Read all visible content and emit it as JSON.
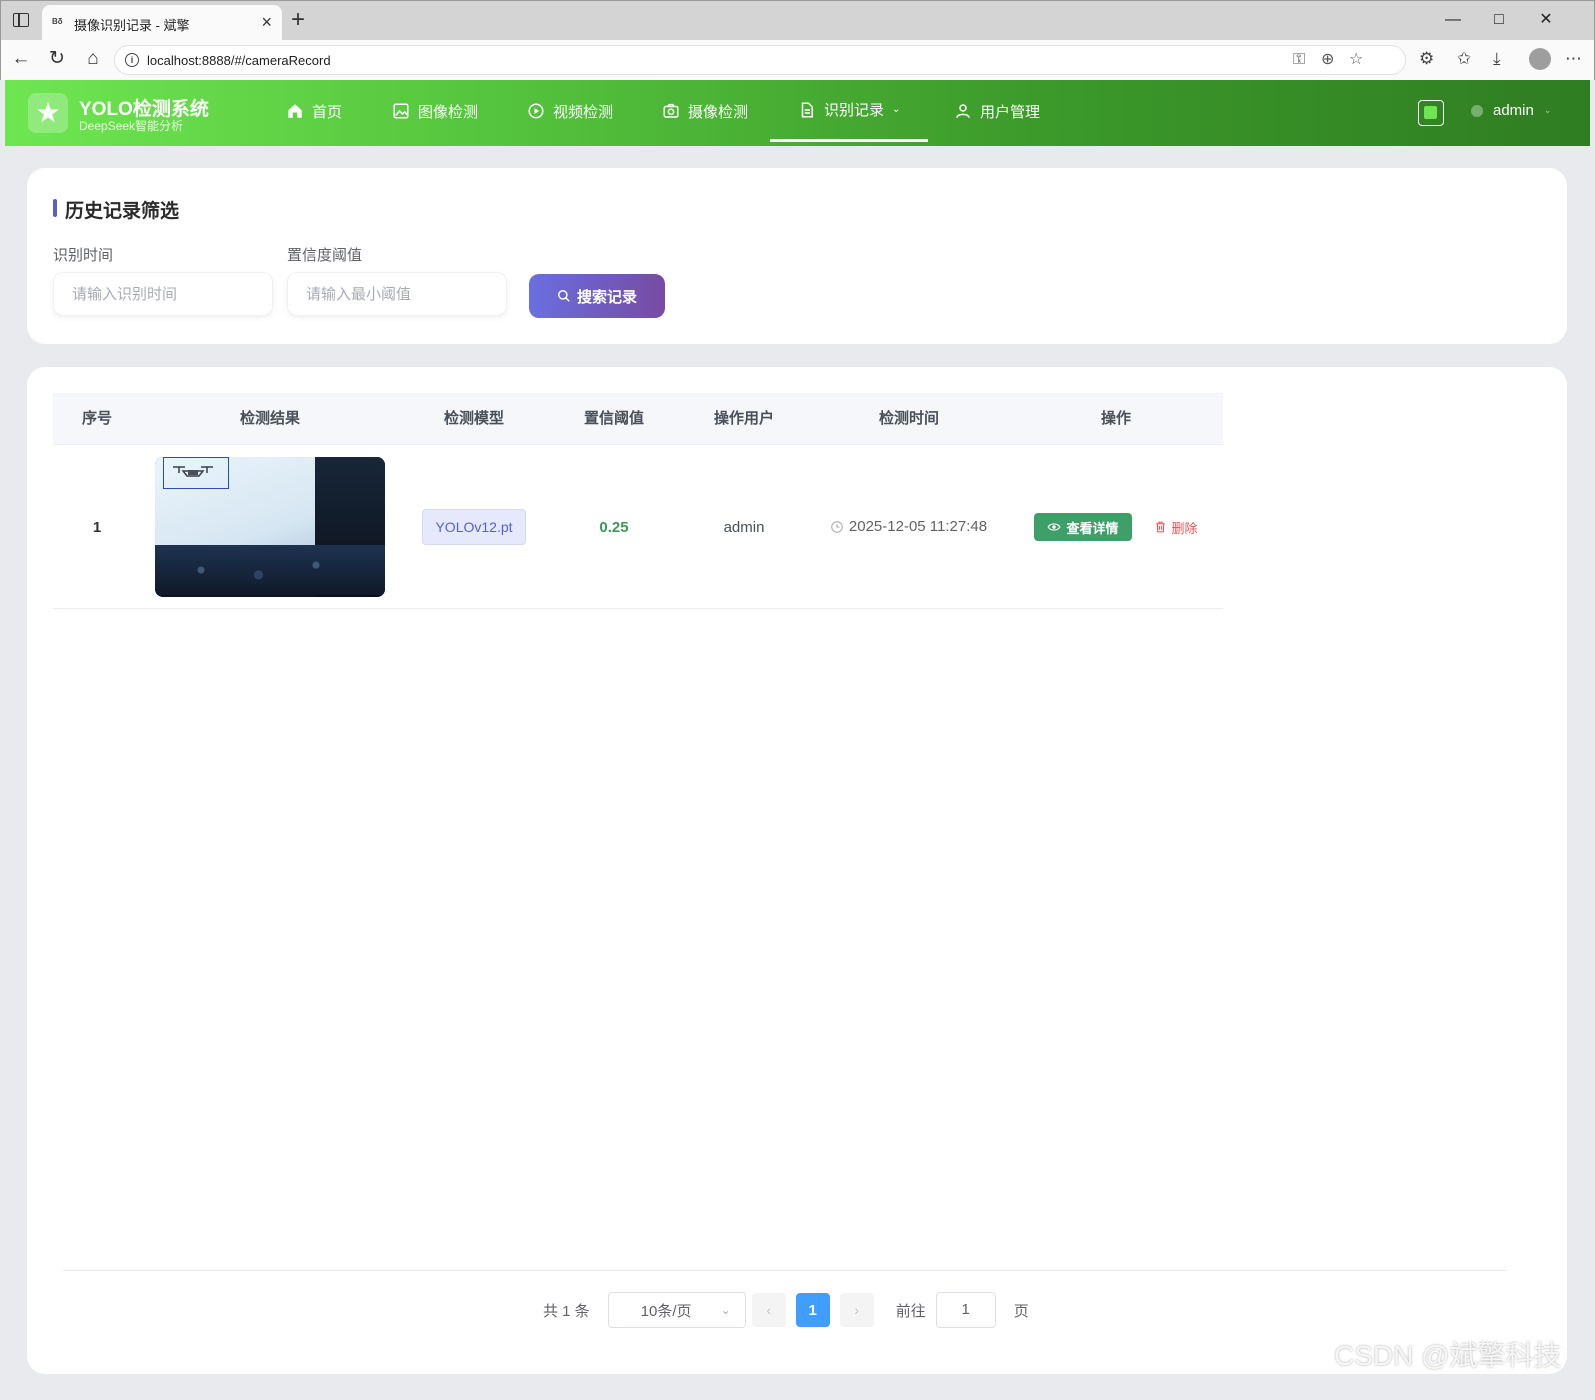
{
  "browser": {
    "tab_favicon": "Bδ",
    "tab_title": "摄像识别记录 - 斌擎",
    "url": "localhost:8888/#/cameraRecord"
  },
  "app": {
    "title": "YOLO检测系统",
    "subtitle": "DeepSeek智能分析",
    "nav": [
      {
        "label": "首页",
        "icon": "home-icon"
      },
      {
        "label": "图像检测",
        "icon": "image-icon"
      },
      {
        "label": "视频检测",
        "icon": "play-circle-icon"
      },
      {
        "label": "摄像检测",
        "icon": "camera-icon"
      },
      {
        "label": "识别记录",
        "icon": "document-icon",
        "active": true
      },
      {
        "label": "用户管理",
        "icon": "user-icon"
      }
    ],
    "user": "admin",
    "accent": "#56c53e"
  },
  "filter": {
    "title": "历史记录筛选",
    "time_label": "识别时间",
    "time_placeholder": "请输入识别时间",
    "conf_label": "置信度阈值",
    "conf_placeholder": "请输入最小阈值",
    "search_label": "搜索记录"
  },
  "table": {
    "headers": [
      "序号",
      "检测结果",
      "检测模型",
      "置信阈值",
      "操作用户",
      "检测时间",
      "操作"
    ],
    "rows": [
      {
        "index": "1",
        "model": "YOLOv12.pt",
        "confidence": "0.25",
        "user": "admin",
        "time": "2025-12-05 11:27:48",
        "detail_label": "查看详情",
        "delete_label": "删除"
      }
    ]
  },
  "pagination": {
    "total": "共 1 条",
    "page_size": "10条/页",
    "current_page": "1",
    "goto_label": "前往",
    "goto_value": "1",
    "page_suffix": "页"
  },
  "watermark": "CSDN @斌擎科技"
}
